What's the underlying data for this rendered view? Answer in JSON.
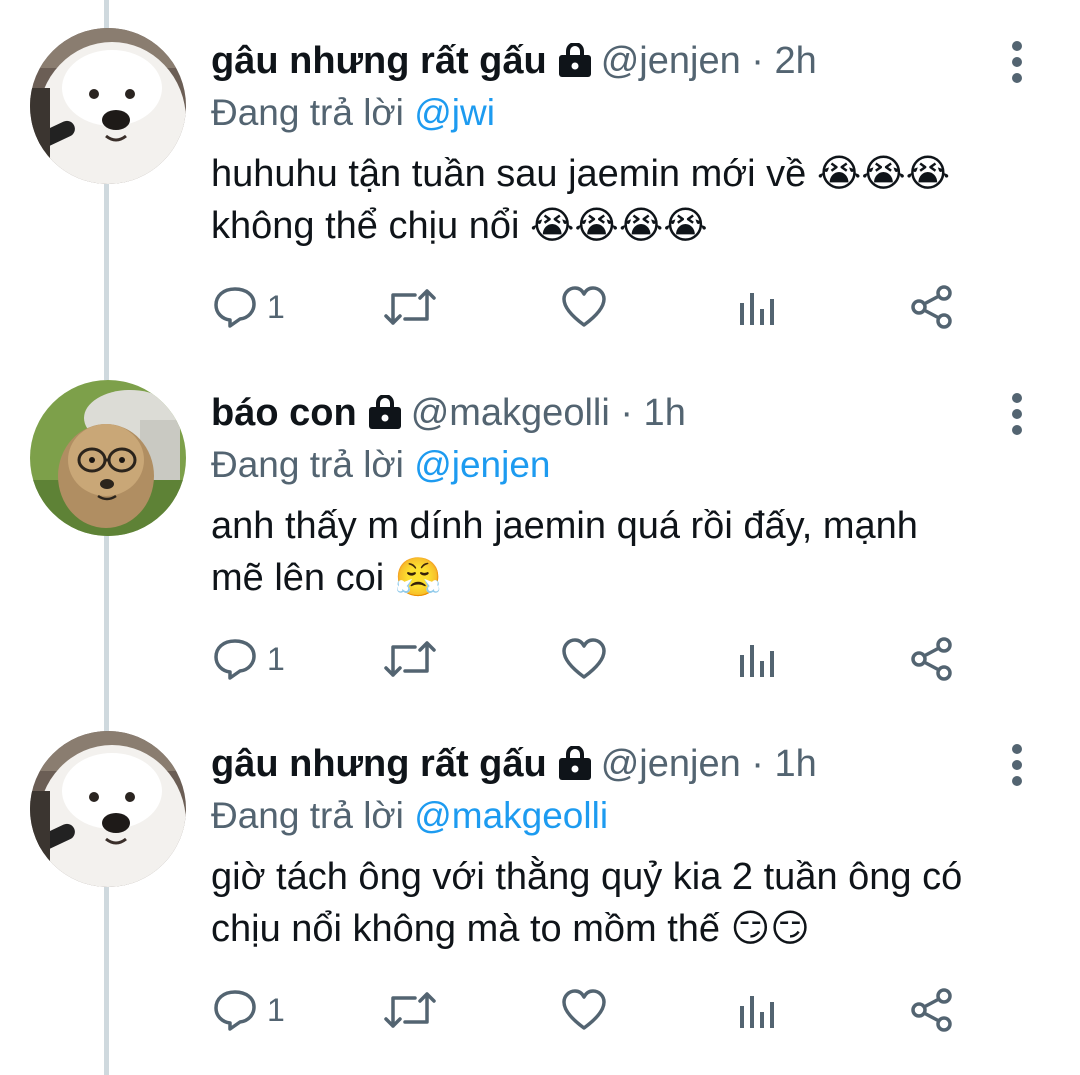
{
  "tweets": [
    {
      "display_name": "gâu nhưng rất gấu",
      "handle": "@jenjen",
      "time": "· 2h",
      "reply_prefix": "Đang trả lời",
      "reply_to": "@jwi",
      "text_line1": "huhuhu tận tuần sau jaemin mới về 😭😭😭",
      "text_line2": "không thể chịu nổi 😭😭😭😭",
      "reply_count": "1",
      "avatar": "dog-avatar"
    },
    {
      "display_name": "báo con",
      "handle": "@makgeolli",
      "time": "· 1h",
      "reply_prefix": "Đang trả lời",
      "reply_to": "@jenjen",
      "text_line1": "anh thấy m dính jaemin quá rồi đấy, mạnh",
      "text_line2": "mẽ lên coi 😤",
      "reply_count": "1",
      "avatar": "cheetah-cub-avatar"
    },
    {
      "display_name": "gâu nhưng rất gấu",
      "handle": "@jenjen",
      "time": "· 1h",
      "reply_prefix": "Đang trả lời",
      "reply_to": "@makgeolli",
      "text_line1": "giờ tách ông với thằng quỷ kia 2 tuần ông có",
      "text_line2": "chịu nổi không mà to mồm thế 😏😏",
      "reply_count": "1",
      "avatar": "dog-avatar"
    }
  ],
  "icons": {
    "reply": "reply-icon",
    "retweet": "retweet-icon",
    "like": "like-icon",
    "views": "views-icon",
    "share": "share-icon",
    "more": "more-icon",
    "lock": "lock-icon"
  },
  "colors": {
    "link": "#1d9bf0",
    "secondary_text": "#536471",
    "thread_line": "#cfd9de"
  }
}
